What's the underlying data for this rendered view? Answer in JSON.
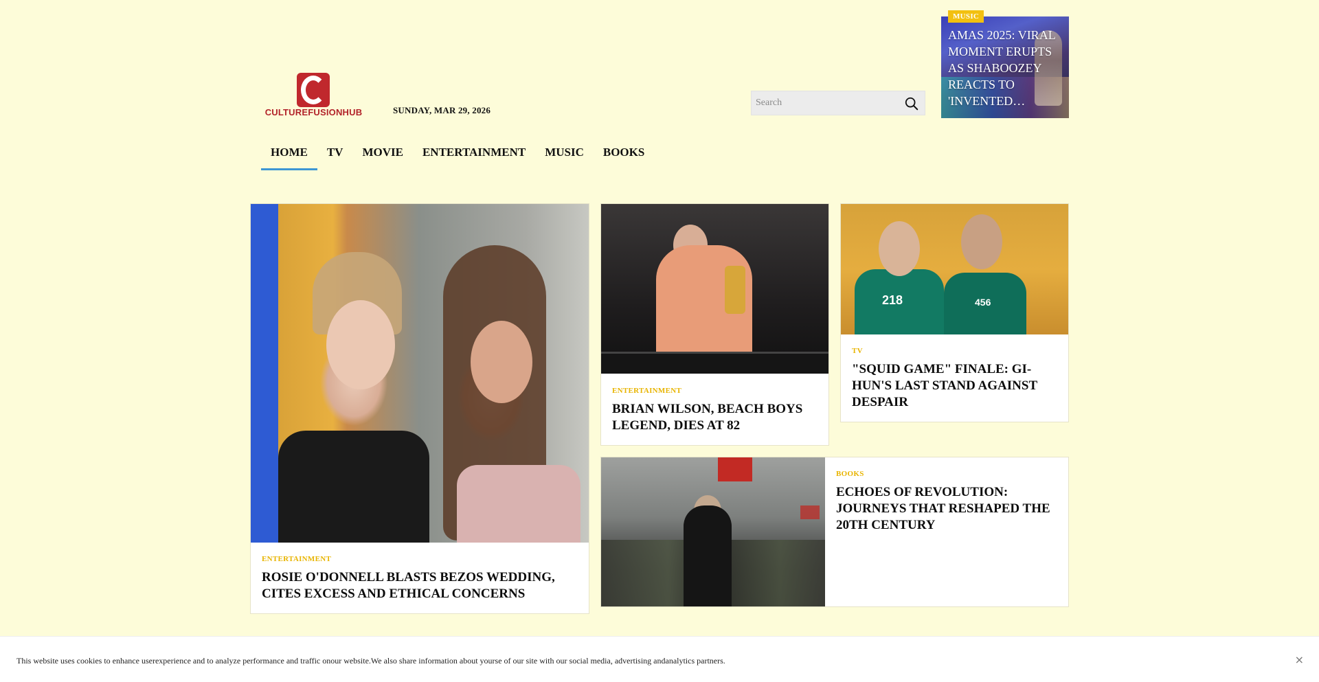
{
  "brand": {
    "name": "CULTUREFUSIONHUB",
    "color": "#b2232a"
  },
  "header": {
    "date": "SUNDAY, MAR 29, 2026"
  },
  "search": {
    "placeholder": "Search",
    "icon": "search-icon"
  },
  "top_story": {
    "category": "MUSIC",
    "title": "AMAS 2025: VIRAL MOMENT ERUPTS AS SHABOOZEY REACTS TO 'INVENTED…"
  },
  "nav": {
    "items": [
      {
        "label": "HOME",
        "active": true
      },
      {
        "label": "TV"
      },
      {
        "label": "MOVIE"
      },
      {
        "label": "ENTERTAINMENT"
      },
      {
        "label": "MUSIC"
      },
      {
        "label": "BOOKS"
      }
    ],
    "active_color": "#3d96d3"
  },
  "cards": [
    {
      "category": "ENTERTAINMENT",
      "title": "ROSIE O'DONNELL BLASTS BEZOS WEDDING, CITES EXCESS AND ETHICAL CONCERNS"
    },
    {
      "category": "ENTERTAINMENT",
      "title": "BRIAN WILSON, BEACH BOYS LEGEND, DIES AT 82"
    },
    {
      "category": "TV",
      "title": "\"SQUID GAME\" FINALE: GI-HUN'S LAST STAND AGAINST DESPAIR"
    },
    {
      "category": "BOOKS",
      "title": "ECHOES OF REVOLUTION: JOURNEYS THAT RESHAPED THE 20TH CENTURY"
    }
  ],
  "category_color": "#e8b400",
  "cookie": {
    "message": "This website uses cookies to enhance userexperience and to analyze performance and traffic onour website.We also share information about yourse of our site with our social media, advertising andanalytics partners.",
    "close": "×"
  }
}
